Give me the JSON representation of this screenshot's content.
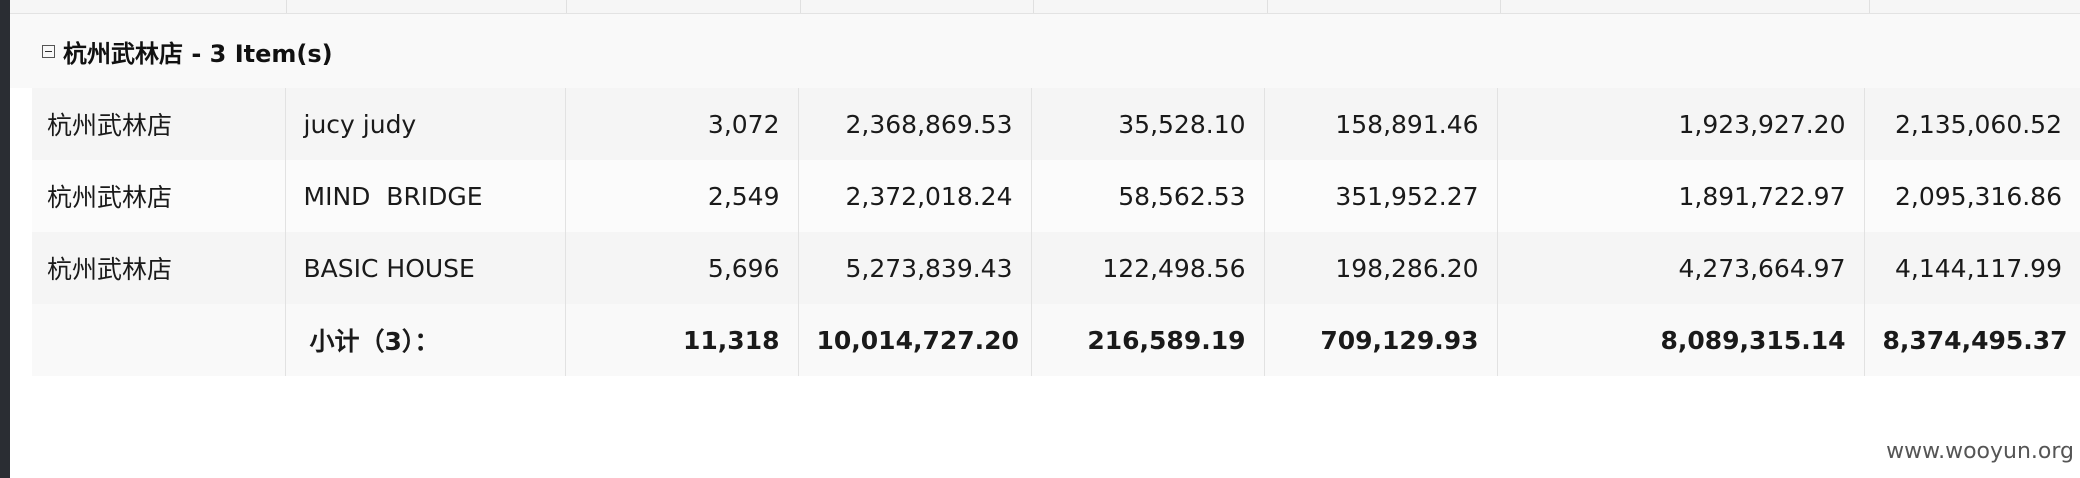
{
  "group": {
    "title": "杭州武林店 - 3 Item(s)"
  },
  "rows": [
    {
      "store": "杭州武林店",
      "brand": "jucy judy",
      "v1": "3,072",
      "v2": "2,368,869.53",
      "v3": "35,528.10",
      "v4": "158,891.46",
      "v5": "1,923,927.20",
      "v6": "2,135,060.52"
    },
    {
      "store": "杭州武林店",
      "brand": "MIND  BRIDGE",
      "v1": "2,549",
      "v2": "2,372,018.24",
      "v3": "58,562.53",
      "v4": "351,952.27",
      "v5": "1,891,722.97",
      "v6": "2,095,316.86"
    },
    {
      "store": "杭州武林店",
      "brand": "BASIC HOUSE",
      "v1": "5,696",
      "v2": "5,273,839.43",
      "v3": "122,498.56",
      "v4": "198,286.20",
      "v5": "4,273,664.97",
      "v6": "4,144,117.99"
    }
  ],
  "subtotal": {
    "label": "小计（3）：",
    "v1": "11,318",
    "v2": "10,014,727.20",
    "v3": "216,589.19",
    "v4": "709,129.93",
    "v5": "8,089,315.14",
    "v6": "8,374,495.37"
  },
  "watermark": "www.wooyun.org",
  "colors": {
    "left_bar": "#2a2d33",
    "row_odd": "#f5f5f5",
    "row_even": "#fbfbfb",
    "grid_line": "#e2e2e2"
  }
}
